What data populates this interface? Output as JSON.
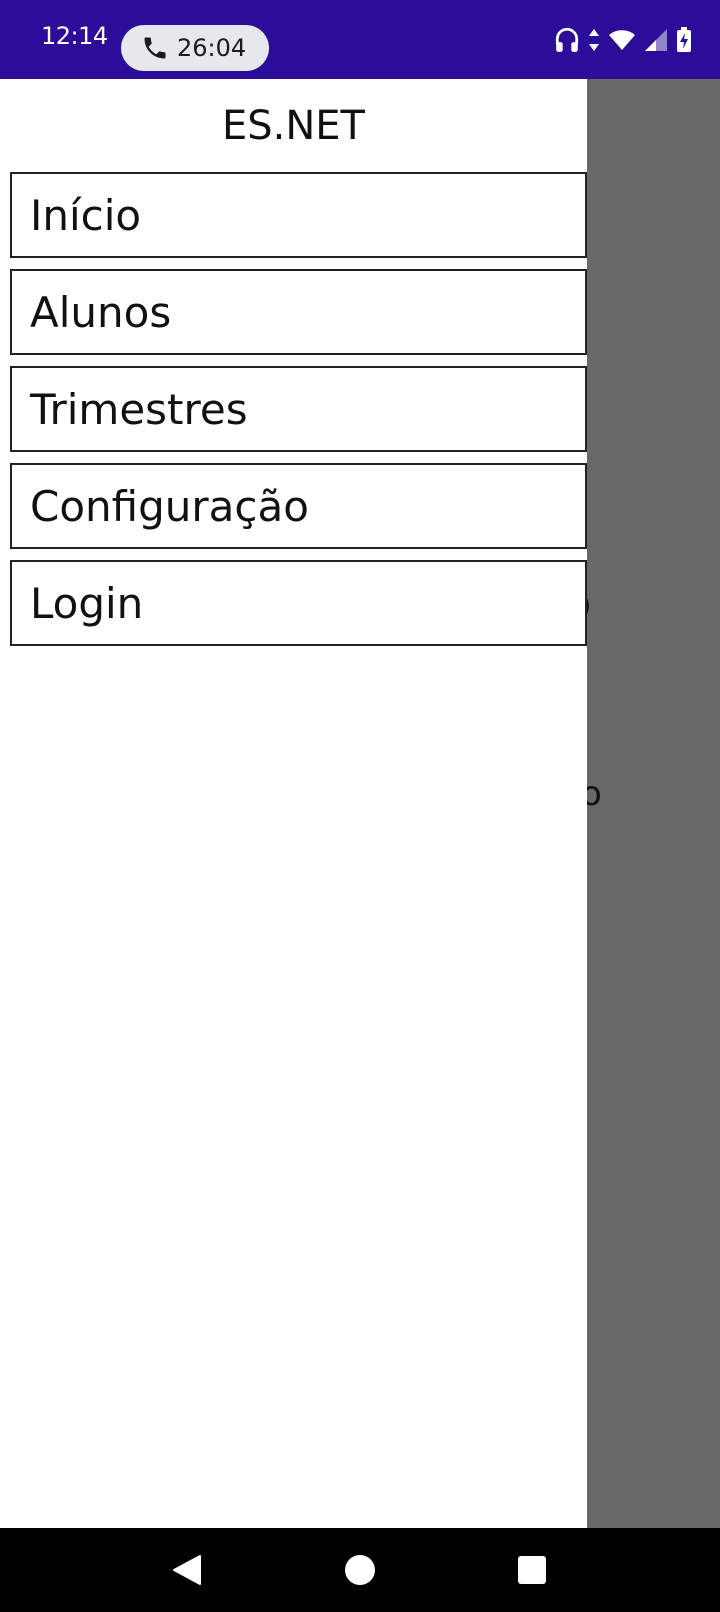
{
  "status_bar": {
    "time": "12:14",
    "call_timer": "26:04",
    "background_color": "#2c0d99",
    "icons": [
      "headset-icon",
      "data-arrows-icon",
      "wifi-icon",
      "cell-signal-icon",
      "battery-charging-icon"
    ]
  },
  "drawer": {
    "title": "ES.NET",
    "items": [
      {
        "label": "Início"
      },
      {
        "label": "Alunos"
      },
      {
        "label": "Trimestres"
      },
      {
        "label": "Configuração"
      },
      {
        "label": "Login"
      }
    ]
  },
  "underlay": {
    "scrim_color": "#686868",
    "peek_texts": [
      ")",
      ".",
      "o"
    ]
  },
  "nav_bar": {
    "icons": [
      "back-icon",
      "home-icon",
      "recents-icon"
    ]
  }
}
